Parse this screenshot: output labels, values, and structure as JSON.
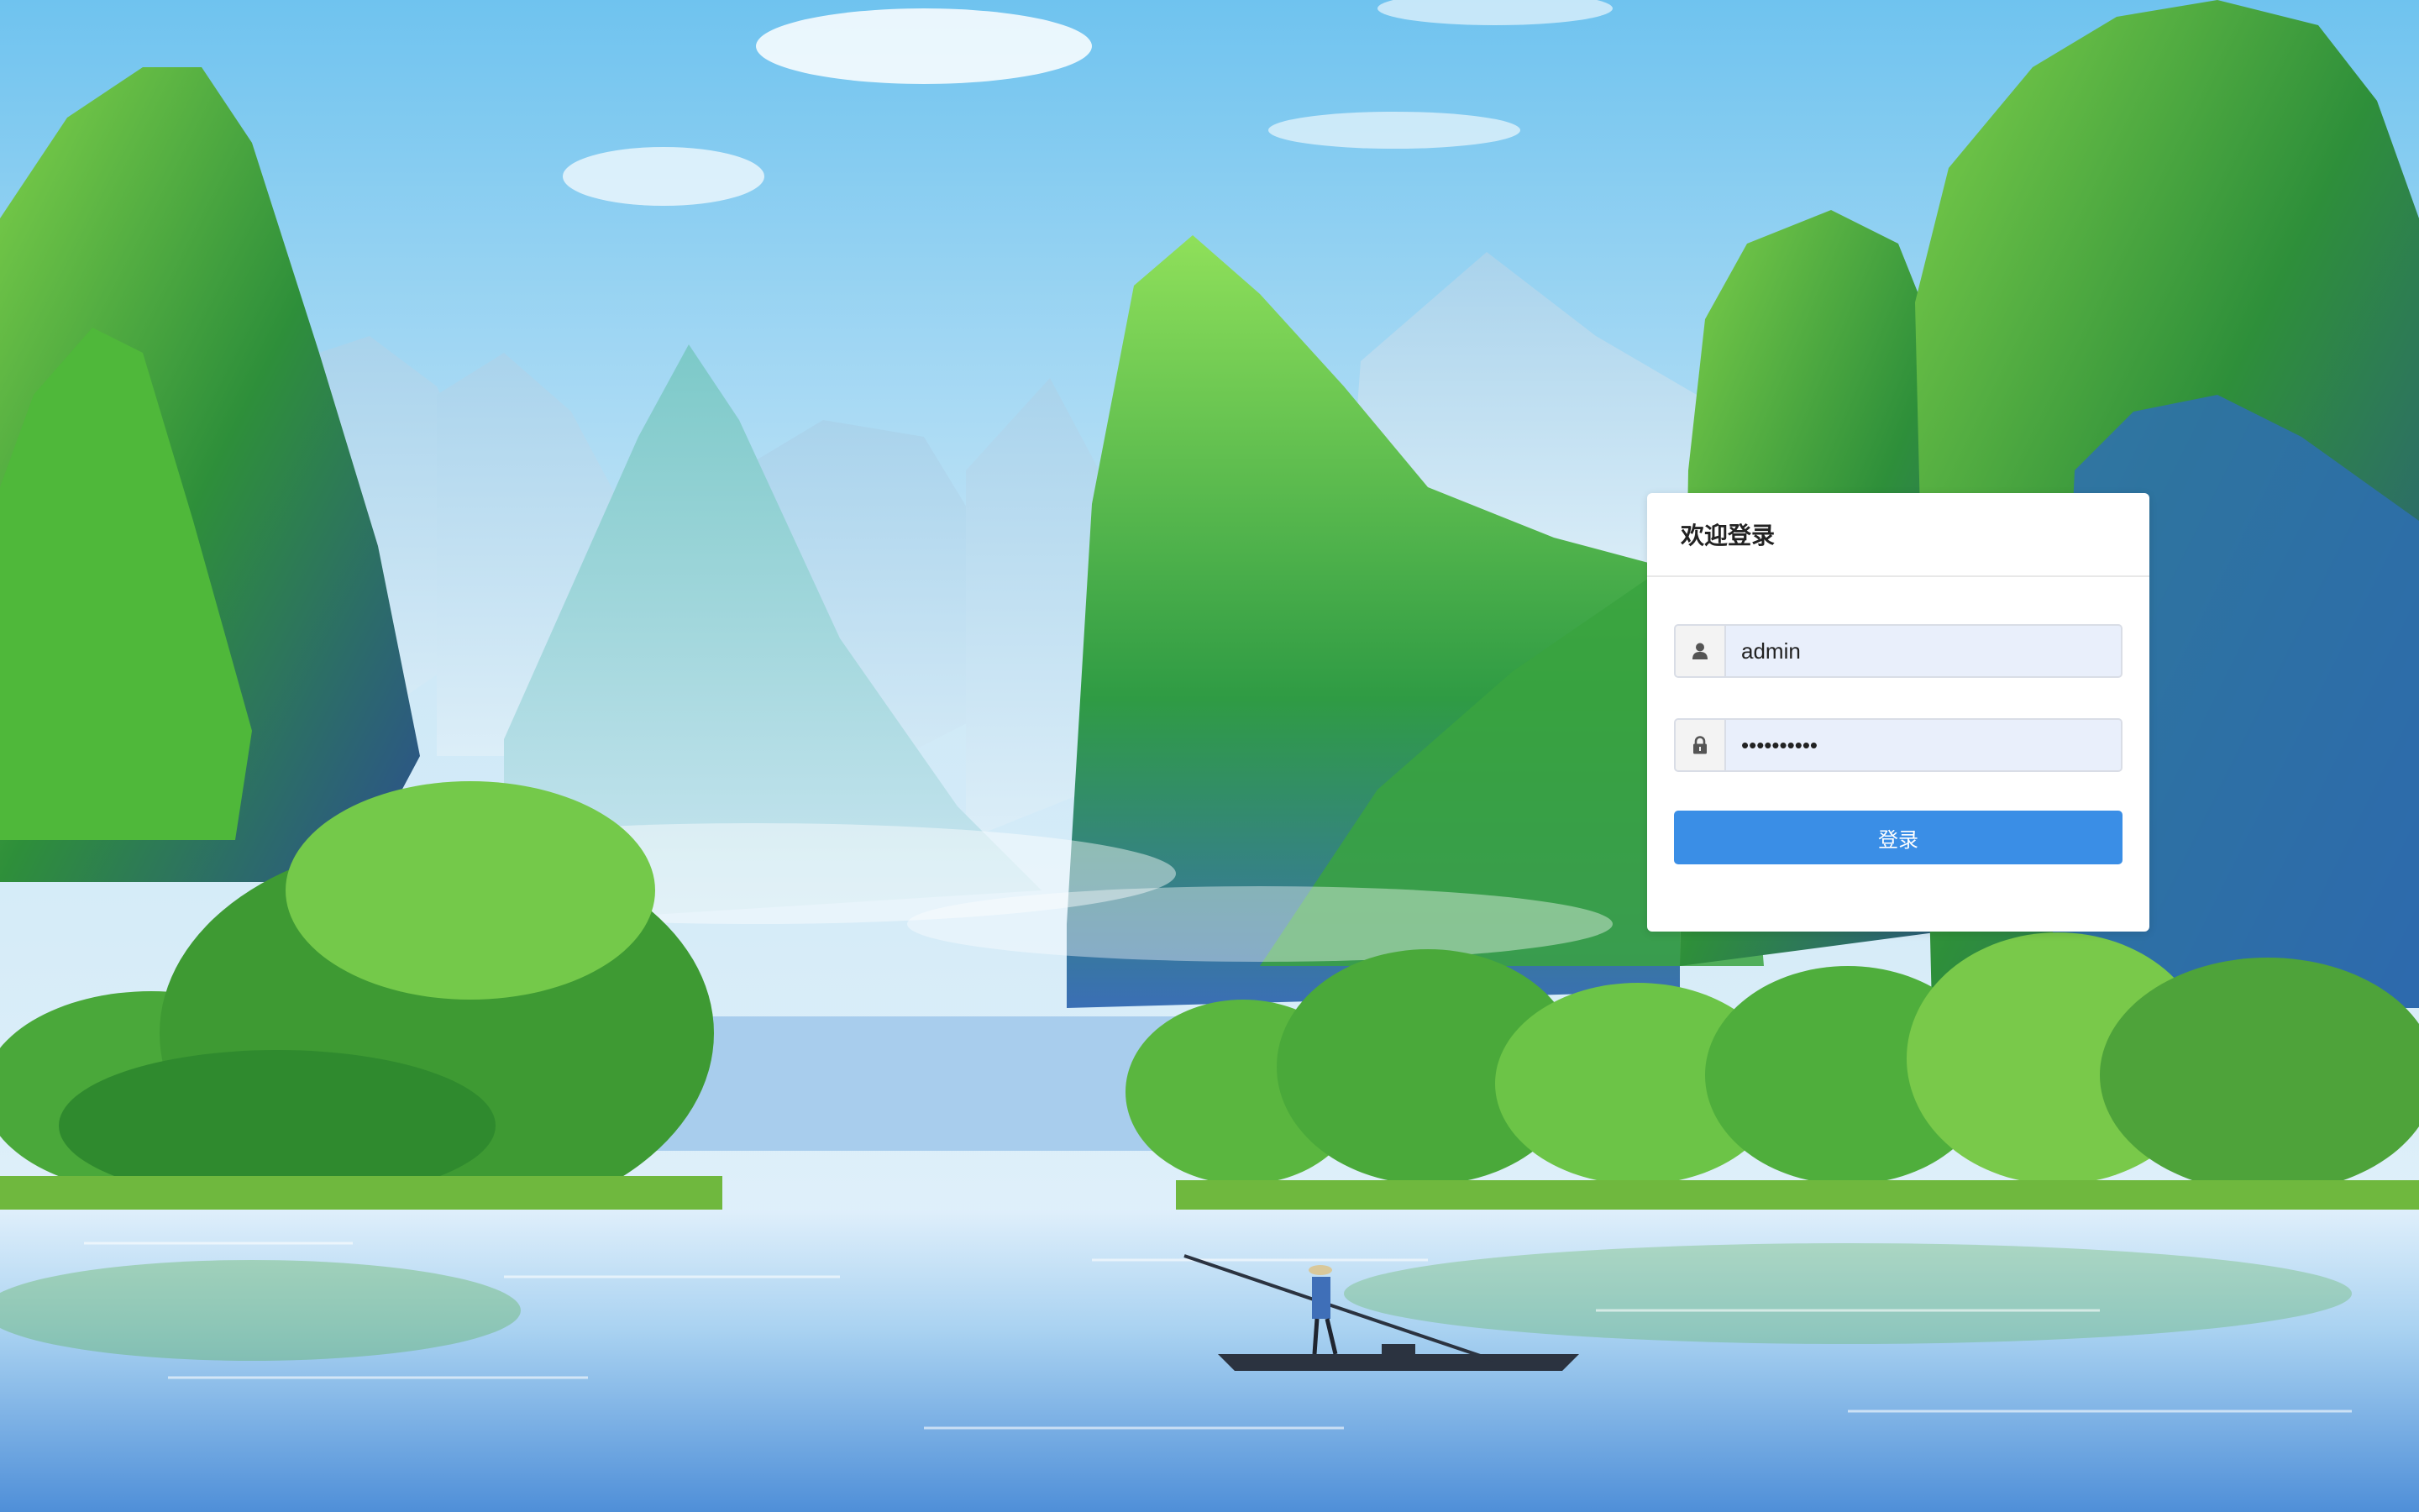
{
  "login": {
    "title": "欢迎登录",
    "username": {
      "value": "admin",
      "icon": "user-icon"
    },
    "password": {
      "value": "••••••••••",
      "icon": "lock-icon"
    },
    "submit_label": "登录"
  },
  "colors": {
    "primary": "#3a8ee6",
    "input_bg": "#e9effb",
    "card_bg": "#ffffff"
  }
}
